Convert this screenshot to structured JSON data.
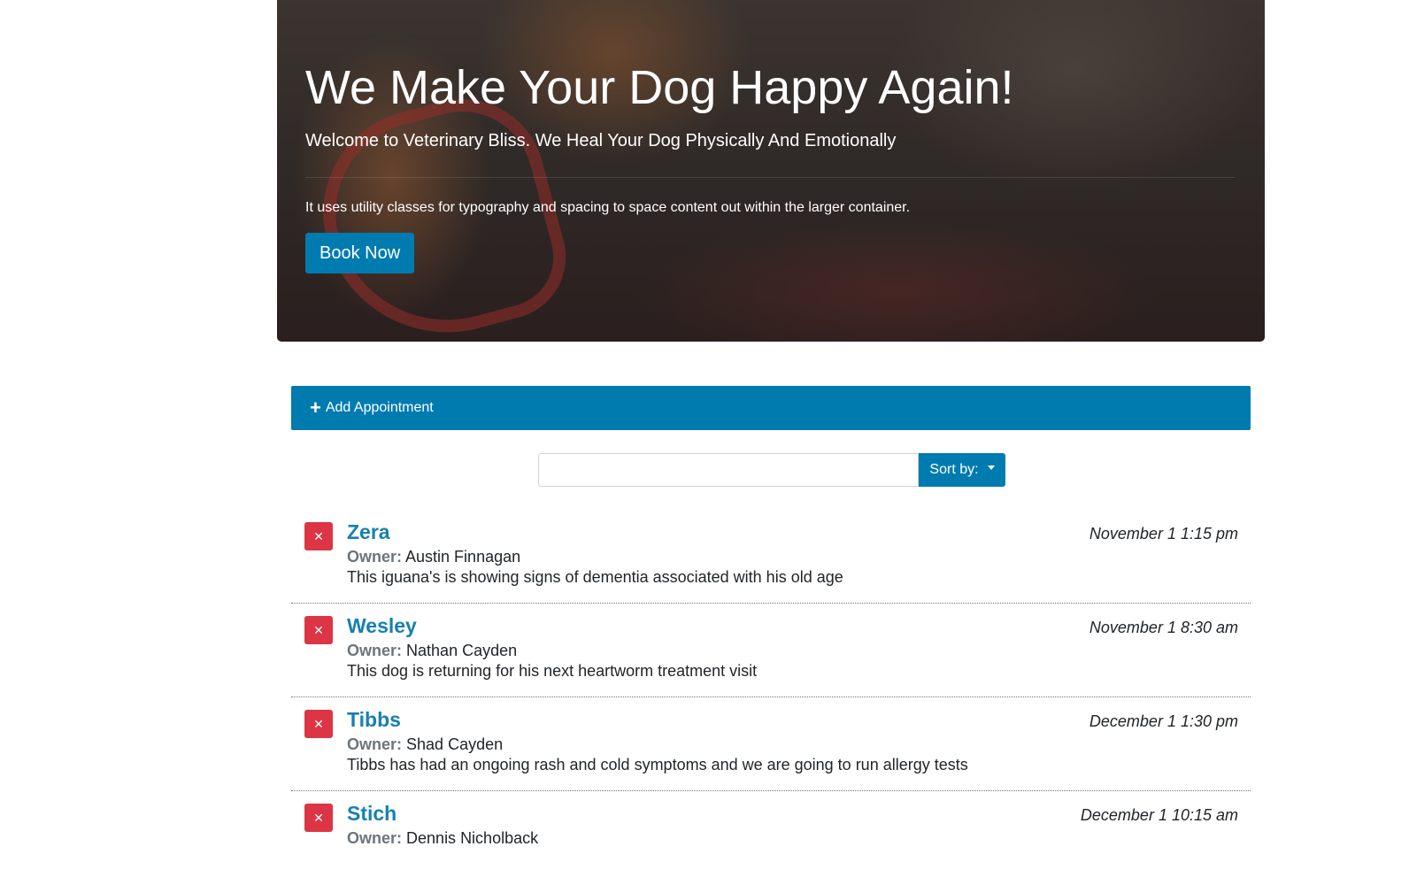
{
  "hero": {
    "title": "We Make Your Dog Happy Again!",
    "lead": "Welcome to Veterinary Bliss. We Heal Your Dog Physically And Emotionally",
    "text": "It uses utility classes for typography and spacing to space content out within the larger container.",
    "button_label": "Book Now"
  },
  "add_appointment": {
    "icon": "plus-icon",
    "label": "Add Appointment"
  },
  "search": {
    "value": "",
    "sort_label": "Sort by:"
  },
  "colors": {
    "primary": "#007bb0",
    "danger": "#dc3545",
    "pet_name": "#1581b0",
    "muted": "#6c757d"
  },
  "appointments": [
    {
      "pet_name": "Zera",
      "date": "November 1 1:15 pm",
      "owner_label": "Owner:",
      "owner": "Austin Finnagan",
      "notes": "This iguana's is showing signs of dementia associated with his old age"
    },
    {
      "pet_name": "Wesley",
      "date": "November 1 8:30 am",
      "owner_label": "Owner:",
      "owner": "Nathan Cayden",
      "notes": "This dog is returning for his next heartworm treatment visit"
    },
    {
      "pet_name": "Tibbs",
      "date": "December 1 1:30 pm",
      "owner_label": "Owner:",
      "owner": "Shad Cayden",
      "notes": "Tibbs has had an ongoing rash and cold symptoms and we are going to run allergy tests"
    },
    {
      "pet_name": "Stich",
      "date": "December 1 10:15 am",
      "owner_label": "Owner:",
      "owner": "Dennis Nicholback",
      "notes": ""
    }
  ]
}
